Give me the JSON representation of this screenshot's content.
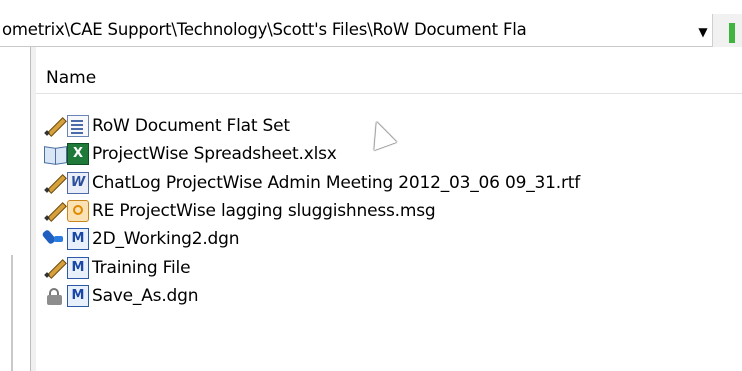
{
  "address_bar": {
    "path": "ometrix\\CAE Support\\Technology\\Scott's Files\\RoW Document Fla",
    "dropdown_icon": "chevron-down-icon"
  },
  "list": {
    "column_header": "Name",
    "items": [
      {
        "label": "RoW Document Flat Set",
        "status_icon": "pencil-icon",
        "type_icon": "document-set-icon"
      },
      {
        "label": "ProjectWise Spreadsheet.xlsx",
        "status_icon": "open-book-icon",
        "type_icon": "excel-icon"
      },
      {
        "label": "ChatLog ProjectWise Admin Meeting 2012_03_06 09_31.rtf",
        "status_icon": "pencil-icon",
        "type_icon": "wordpad-icon"
      },
      {
        "label": "RE  ProjectWise lagging sluggishness.msg",
        "status_icon": "pencil-icon",
        "type_icon": "outlook-message-icon"
      },
      {
        "label": "2D_Working2.dgn",
        "status_icon": "checkout-pin-icon",
        "type_icon": "microstation-icon"
      },
      {
        "label": "Training File",
        "status_icon": "pencil-icon",
        "type_icon": "microstation-icon"
      },
      {
        "label": "Save_As.dgn",
        "status_icon": "lock-icon",
        "type_icon": "microstation-icon"
      }
    ]
  }
}
